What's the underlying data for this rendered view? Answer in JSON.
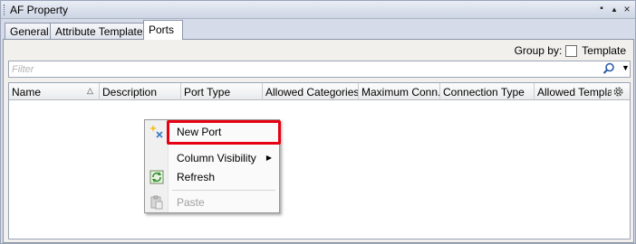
{
  "window": {
    "title": "AF Property",
    "pin_glyph": "▪",
    "collapse_glyph": "▲",
    "close_glyph": "×"
  },
  "tabs": [
    {
      "label": "General",
      "active": false
    },
    {
      "label": "Attribute Templates",
      "active": false
    },
    {
      "label": "Ports",
      "active": true
    }
  ],
  "toolbar": {
    "group_by_label": "Group by:",
    "template_checkbox_label": "Template",
    "template_checked": false
  },
  "filter": {
    "placeholder": "Filter",
    "value": "",
    "dropdown_glyph": "▼"
  },
  "grid": {
    "columns": [
      "Name",
      "Description",
      "Port Type",
      "Allowed Categories",
      "Maximum Conn...",
      "Connection Type",
      "Allowed Template"
    ],
    "sort_glyph": "△",
    "rows": []
  },
  "context_menu": {
    "items": [
      {
        "label": "New Port",
        "icon": "new-port-icon",
        "enabled": true,
        "highlighted": true
      },
      {
        "label": "Column Visibility",
        "icon": "",
        "enabled": true,
        "submenu": true
      },
      {
        "label": "Refresh",
        "icon": "refresh-icon",
        "enabled": true
      },
      {
        "label": "Paste",
        "icon": "paste-icon",
        "enabled": false
      }
    ],
    "submenu_glyph": "▶"
  },
  "colors": {
    "highlight_border": "#e60012",
    "chrome": "#d6dbe9"
  }
}
